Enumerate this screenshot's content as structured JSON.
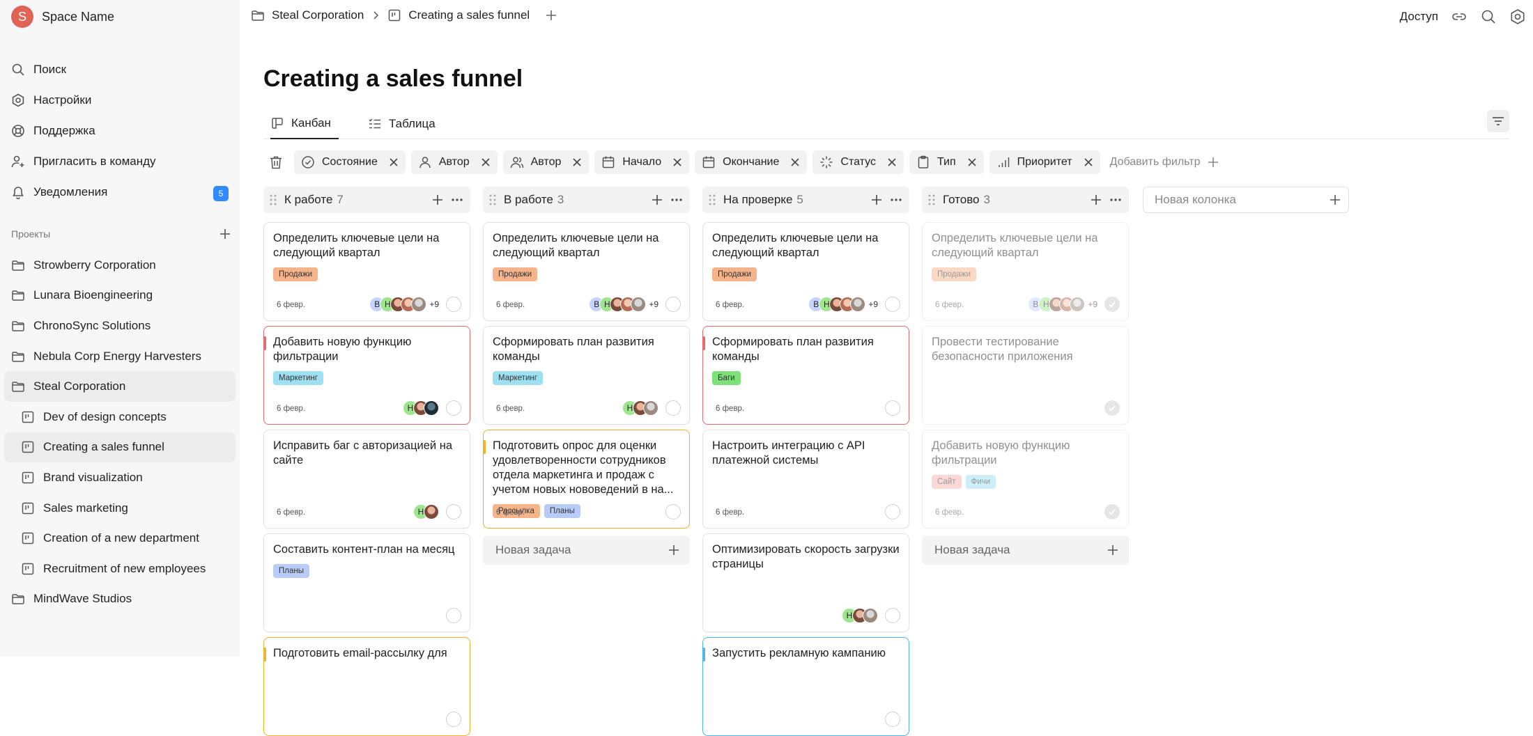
{
  "space": {
    "initial": "S",
    "name": "Space Name"
  },
  "nav": [
    {
      "label": "Поиск",
      "icon": "search-icon"
    },
    {
      "label": "Настройки",
      "icon": "settings-icon"
    },
    {
      "label": "Поддержка",
      "icon": "support-icon"
    },
    {
      "label": "Пригласить в команду",
      "icon": "invite-icon"
    },
    {
      "label": "Уведомления",
      "icon": "bell-icon",
      "badge": "5"
    }
  ],
  "projects": {
    "heading": "Проекты",
    "items": [
      {
        "label": "Strowberry Corporation",
        "type": "folder"
      },
      {
        "label": "Lunara Bioengineering",
        "type": "folder"
      },
      {
        "label": "ChronoSync Solutions",
        "type": "folder"
      },
      {
        "label": "Nebula Corp Energy Harvesters",
        "type": "folder"
      },
      {
        "label": "Steal Corporation",
        "type": "folder"
      },
      {
        "label": "Dev of design concepts",
        "type": "board"
      },
      {
        "label": "Creating a sales funnel",
        "type": "board"
      },
      {
        "label": "Brand visualization",
        "type": "board"
      },
      {
        "label": "Sales marketing",
        "type": "board"
      },
      {
        "label": "Creation of a new department",
        "type": "board"
      },
      {
        "label": "Recruitment of new employees",
        "type": "board"
      },
      {
        "label": "MindWave Studios",
        "type": "folder"
      }
    ]
  },
  "breadcrumb": {
    "folder": "Steal Corporation",
    "board": "Creating a sales funnel"
  },
  "topbar": {
    "access": "Доступ"
  },
  "page": {
    "title": "Creating a sales funnel"
  },
  "tabs": [
    {
      "label": "Канбан"
    },
    {
      "label": "Таблица"
    }
  ],
  "filters": [
    {
      "label": "Состояние",
      "icon": "status-check-icon"
    },
    {
      "label": "Автор",
      "icon": "user-icon"
    },
    {
      "label": "Автор",
      "icon": "users-icon"
    },
    {
      "label": "Начало",
      "icon": "calendar-icon"
    },
    {
      "label": "Окончание",
      "icon": "calendar-icon"
    },
    {
      "label": "Статус",
      "icon": "loader-icon"
    },
    {
      "label": "Тип",
      "icon": "clipboard-icon"
    },
    {
      "label": "Приоритет",
      "icon": "signal-icon"
    }
  ],
  "add_filter": "Добавить фильтр",
  "new_column": "Новая колонка",
  "new_task": "Новая задача",
  "colors": {
    "accent_red": "#e86a6a",
    "accent_orange": "#f0b429",
    "accent_blue": "#4db6e6",
    "badge_blue": "#2f8bff"
  },
  "columns": [
    {
      "title": "К работе",
      "count": "7",
      "cards": [
        {
          "title": "Определить ключевые цели на следующий квартал",
          "tags": [
            {
              "label": "Продажи",
              "color": "orange"
            }
          ],
          "date": "6 февр.",
          "avatars": [
            "В",
            "Н",
            "p",
            "p2",
            "p3"
          ],
          "more": "+9"
        },
        {
          "title": "Добавить новую функцию фильтрации",
          "tags": [
            {
              "label": "Маркетинг",
              "color": "cyan"
            }
          ],
          "date": "6 февр.",
          "avatars": [
            "Н",
            "p",
            "dark"
          ],
          "border": "red"
        },
        {
          "title": "Исправить баг с авторизацией на сайте",
          "tags": [],
          "date": "6 февр.",
          "avatars": [
            "Н",
            "p"
          ]
        },
        {
          "title": "Составить контент-план на месяц",
          "tags": [
            {
              "label": "Планы",
              "color": "blue"
            }
          ],
          "date": "",
          "avatars": []
        },
        {
          "title": "Подготовить email-рассылку для",
          "tags": [],
          "date": "",
          "avatars": [],
          "border": "orange"
        }
      ]
    },
    {
      "title": "В работе",
      "count": "3",
      "cards": [
        {
          "title": "Определить ключевые цели на следующий квартал",
          "tags": [
            {
              "label": "Продажи",
              "color": "orange"
            }
          ],
          "date": "6 февр.",
          "avatars": [
            "В",
            "Н",
            "p",
            "p2",
            "p3"
          ],
          "more": "+9"
        },
        {
          "title": "Сформировать план развития команды",
          "tags": [
            {
              "label": "Маркетинг",
              "color": "cyan"
            }
          ],
          "date": "6 февр.",
          "avatars": [
            "Н",
            "p",
            "p3"
          ]
        },
        {
          "title": "Подготовить опрос для оценки удовлетворенности сотрудников отдела маркетинга и продаж с учетом новых нововедений в на...",
          "tags": [
            {
              "label": "Рассылка",
              "color": "orange"
            },
            {
              "label": "Планы",
              "color": "blue"
            }
          ],
          "date": "6 февр.",
          "avatars": [],
          "border": "orange"
        }
      ]
    },
    {
      "title": "На проверке",
      "count": "5",
      "cards": [
        {
          "title": "Определить ключевые цели на следующий квартал",
          "tags": [
            {
              "label": "Продажи",
              "color": "orange"
            }
          ],
          "date": "6 февр.",
          "avatars": [
            "В",
            "Н",
            "p",
            "p2",
            "p3"
          ],
          "more": "+9"
        },
        {
          "title": "Сформировать план развития команды",
          "tags": [
            {
              "label": "Баги",
              "color": "green"
            }
          ],
          "date": "6 февр.",
          "avatars": [],
          "border": "red"
        },
        {
          "title": "Настроить интеграцию с API платежной системы",
          "tags": [],
          "date": "6 февр.",
          "avatars": []
        },
        {
          "title": "Оптимизировать скорость загрузки страницы",
          "tags": [],
          "date": "",
          "avatars": [
            "Н",
            "p",
            "p3"
          ]
        },
        {
          "title": "Запустить рекламную кампанию",
          "tags": [],
          "date": "",
          "avatars": [],
          "border": "blue"
        }
      ]
    },
    {
      "title": "Готово",
      "count": "3",
      "cards": [
        {
          "title": "Определить ключевые цели на следующий квартал",
          "tags": [
            {
              "label": "Продажи",
              "color": "orange"
            }
          ],
          "date": "6 февр.",
          "avatars": [
            "В",
            "Н",
            "p",
            "p2",
            "p3"
          ],
          "more": "+9",
          "done": true
        },
        {
          "title": "Провести тестирование безопасности приложения",
          "tags": [],
          "date": "",
          "avatars": [],
          "done": true
        },
        {
          "title": "Добавить новую функцию фильтрации",
          "tags": [
            {
              "label": "Сайт",
              "color": "pink"
            },
            {
              "label": "Фичи",
              "color": "cyan"
            }
          ],
          "date": "6 февр.",
          "avatars": [],
          "done": true
        }
      ]
    }
  ]
}
